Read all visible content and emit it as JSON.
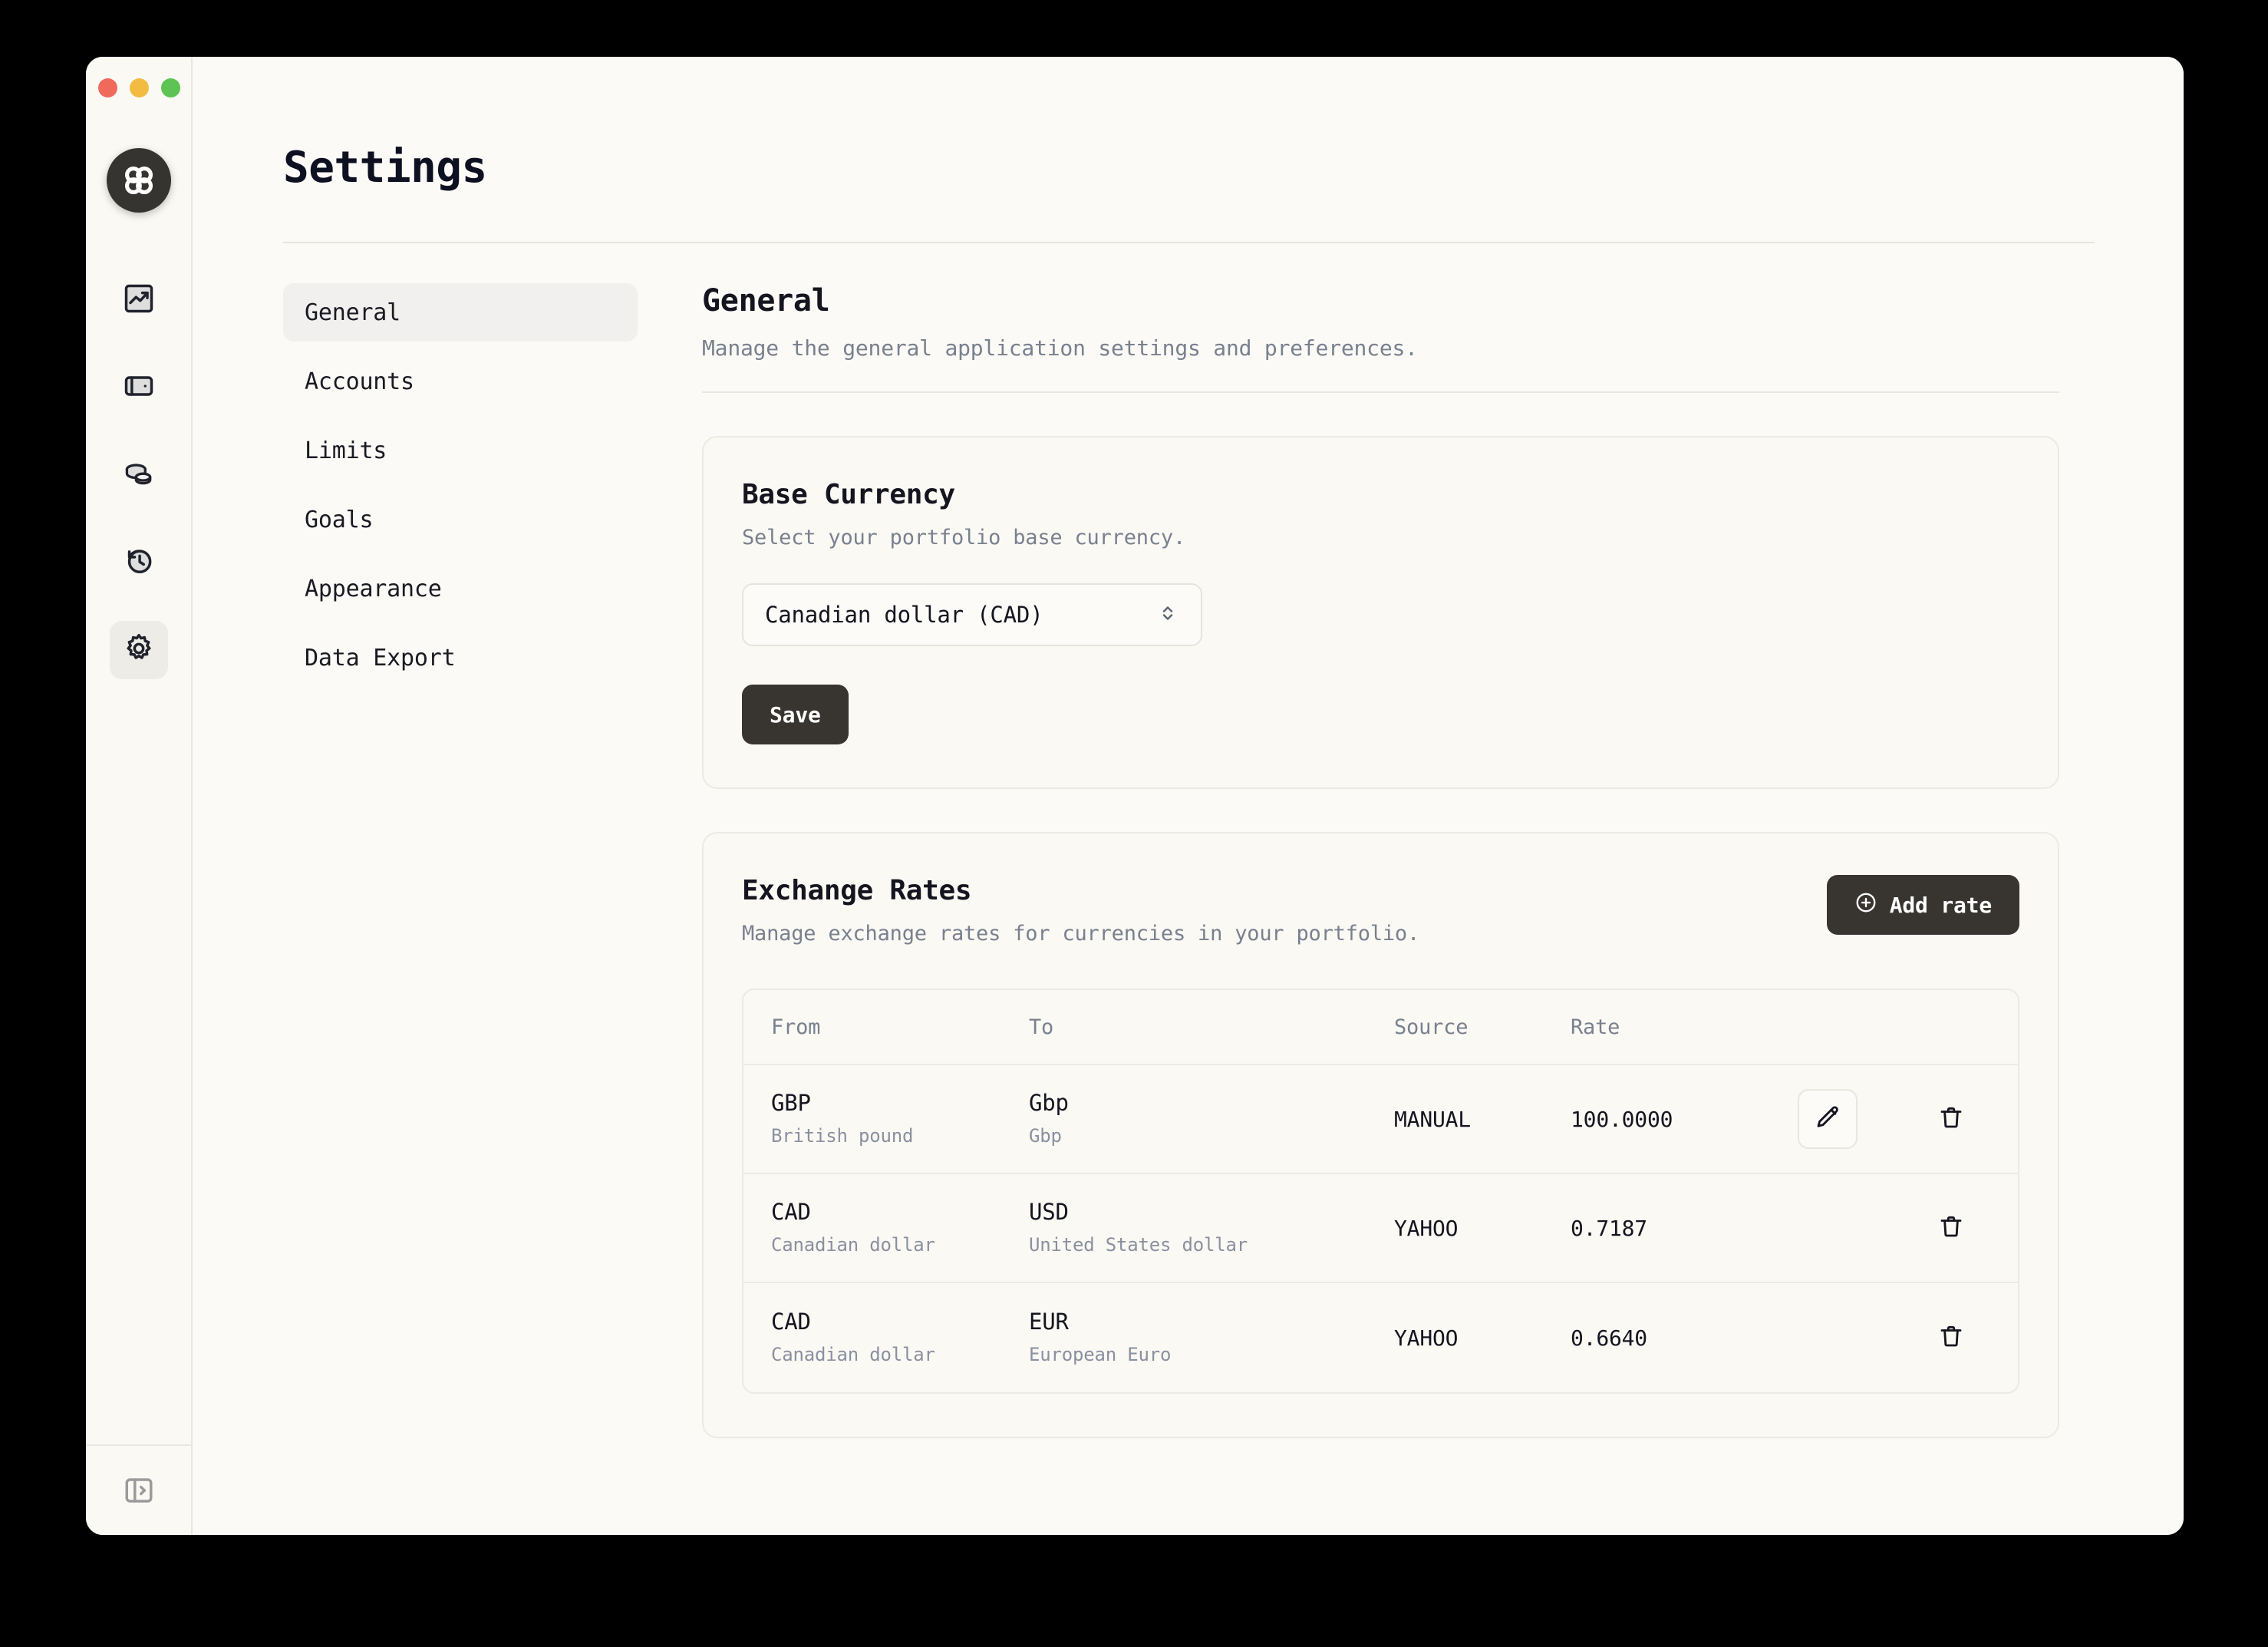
{
  "window": {
    "traffic_lights": [
      "close",
      "minimize",
      "maximize"
    ],
    "logo_icon": "app-logo-clover-icon"
  },
  "rail": {
    "items": [
      {
        "icon": "chart-line-up-icon",
        "name": "dashboard",
        "active": false
      },
      {
        "icon": "wallet-icon",
        "name": "accounts",
        "active": false
      },
      {
        "icon": "coins-icon",
        "name": "holdings",
        "active": false
      },
      {
        "icon": "clock-history-icon",
        "name": "activity",
        "active": false
      },
      {
        "icon": "gear-icon",
        "name": "settings",
        "active": true
      }
    ],
    "bottom_icon": "panel-expand-icon"
  },
  "header": {
    "title": "Settings"
  },
  "settings_nav": {
    "items": [
      {
        "label": "General",
        "active": true
      },
      {
        "label": "Accounts",
        "active": false
      },
      {
        "label": "Limits",
        "active": false
      },
      {
        "label": "Goals",
        "active": false
      },
      {
        "label": "Appearance",
        "active": false
      },
      {
        "label": "Data Export",
        "active": false
      }
    ]
  },
  "section": {
    "title": "General",
    "subtitle": "Manage the general application settings and preferences."
  },
  "base_currency": {
    "title": "Base Currency",
    "subtitle": "Select your portfolio base currency.",
    "selected": "Canadian dollar (CAD)",
    "save_label": "Save"
  },
  "exchange_rates": {
    "title": "Exchange Rates",
    "subtitle": "Manage exchange rates for currencies in your portfolio.",
    "add_label": "Add rate",
    "add_icon": "plus-circle-icon",
    "columns": [
      "From",
      "To",
      "Source",
      "Rate"
    ],
    "rows": [
      {
        "from_code": "GBP",
        "from_name": "British pound",
        "to_code": "Gbp",
        "to_name": "Gbp",
        "source": "MANUAL",
        "rate": "100.0000",
        "has_edit": true
      },
      {
        "from_code": "CAD",
        "from_name": "Canadian dollar",
        "to_code": "USD",
        "to_name": "United States dollar",
        "source": "YAHOO",
        "rate": "0.7187",
        "has_edit": false
      },
      {
        "from_code": "CAD",
        "from_name": "Canadian dollar",
        "to_code": "EUR",
        "to_name": "European Euro",
        "source": "YAHOO",
        "rate": "0.6640",
        "has_edit": false
      }
    ]
  },
  "colors": {
    "window_bg": "#fbfaf6",
    "card_bg": "#fbf9f4",
    "accent_dark": "#383530",
    "text_primary": "#14151f",
    "text_muted": "#79808f",
    "border": "#eceae3",
    "active_nav": "#f1f0ee",
    "traffic_red": "#ef6a5b",
    "traffic_yellow": "#f2bb42",
    "traffic_green": "#5dc353"
  }
}
